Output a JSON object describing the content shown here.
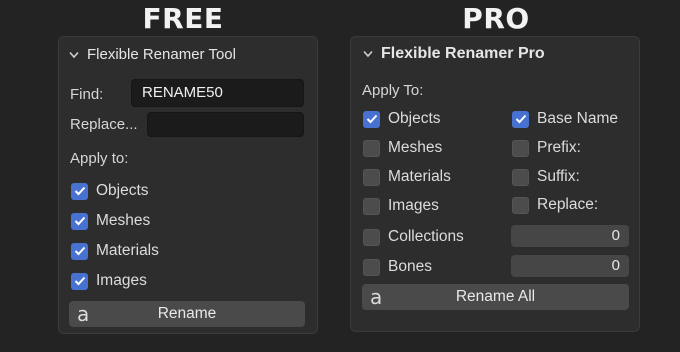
{
  "headings": {
    "free": "FREE",
    "pro": "PRO"
  },
  "free": {
    "title": "Flexible Renamer Tool",
    "find_label": "Find:",
    "find_value": "RENAME50",
    "replace_label": "Replace...",
    "replace_value": "",
    "apply_label": "Apply to:",
    "options": [
      {
        "label": "Objects",
        "checked": true
      },
      {
        "label": "Meshes",
        "checked": true
      },
      {
        "label": "Materials",
        "checked": true
      },
      {
        "label": "Images",
        "checked": true
      }
    ],
    "rename_button": "Rename",
    "button_icon": "a"
  },
  "pro": {
    "title": "Flexible Renamer Pro",
    "apply_label": "Apply To:",
    "left_options": [
      {
        "label": "Objects",
        "checked": true
      },
      {
        "label": "Meshes",
        "checked": false
      },
      {
        "label": "Materials",
        "checked": false
      },
      {
        "label": "Images",
        "checked": false
      },
      {
        "label": "Collections",
        "checked": false
      },
      {
        "label": "Bones",
        "checked": false
      }
    ],
    "right_options": [
      {
        "label": "Base Name",
        "checked": true
      },
      {
        "label": "Prefix:",
        "checked": false
      },
      {
        "label": "Suffix:",
        "checked": false
      },
      {
        "label": "Replace:",
        "checked": false
      }
    ],
    "collections_value": "0",
    "bones_value": "0",
    "rename_all_button": "Rename All",
    "button_icon": "a"
  },
  "colors": {
    "accent": "#4872d1",
    "panel": "#2d2d2d",
    "background": "#232323"
  }
}
